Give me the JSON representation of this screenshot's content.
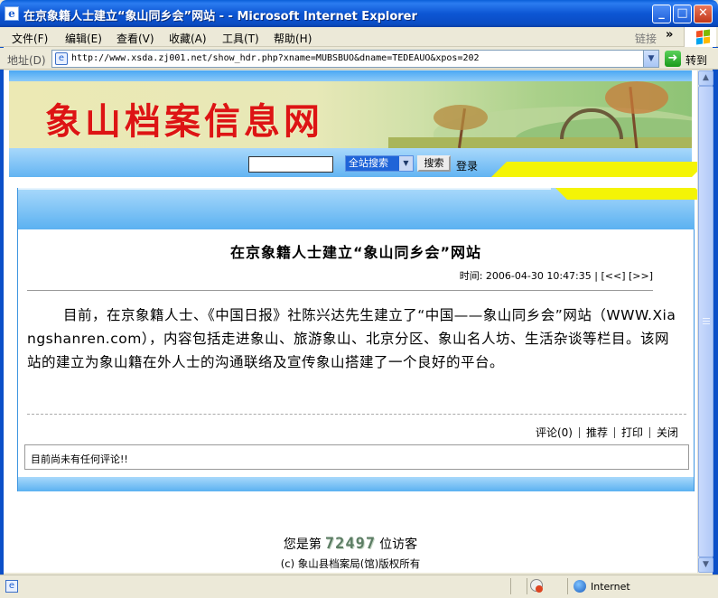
{
  "window": {
    "title": "在京象籍人士建立“象山同乡会”网站 - - Microsoft Internet Explorer",
    "min_glyph": "_",
    "max_glyph": "□",
    "close_glyph": "✕"
  },
  "menu": {
    "items": [
      "文件(F)",
      "编辑(E)",
      "查看(V)",
      "收藏(A)",
      "工具(T)",
      "帮助(H)"
    ],
    "links_label": "链接",
    "chevron": "»"
  },
  "address": {
    "label": "地址(D)",
    "url": "http://www.xsda.zj001.net/show_hdr.php?xname=MUBSBUO&dname=TEDEAUO&xpos=202",
    "go_label": "转到",
    "dropdown_glyph": "▼"
  },
  "site": {
    "name": "象山档案信息网",
    "search_select": "全站搜索",
    "search_button": "搜索",
    "login": "登录"
  },
  "article": {
    "title": "在京象籍人士建立“象山同乡会”网站",
    "meta": "时间: 2006-04-30 10:47:35 | [<<] [>>]",
    "body": "目前，在京象籍人士、《中国日报》社陈兴达先生建立了“中国——象山同乡会”网站（WWW.Xiangshanren.com），内容包括走进象山、旅游象山、北京分区、象山名人坊、生活杂谈等栏目。该网站的建立为象山籍在外人士的沟通联络及宣传象山搭建了一个良好的平台。",
    "actions": [
      "评论(0)",
      "推荐",
      "打印",
      "关闭"
    ],
    "no_comments": "目前尚未有任何评论!!"
  },
  "footer": {
    "visitor_prefix": "您是第",
    "visitor_count": "72497",
    "visitor_suffix": "位访客",
    "copyright": "(c) 象山县档案局(馆)版权所有"
  },
  "status": {
    "zone": "Internet"
  },
  "icons": [
    "ie-icon",
    "minimize-icon",
    "maximize-icon",
    "close-icon",
    "windows-logo-icon",
    "page-icon",
    "go-arrow-icon",
    "dropdown-arrow-icon",
    "privacy-icon",
    "globe-icon"
  ],
  "colors": {
    "titlebar": "#0a4cc4",
    "banner_text": "#dd1414",
    "accent_blue": "#63b4f2",
    "accent_yellow": "#f4f406"
  }
}
